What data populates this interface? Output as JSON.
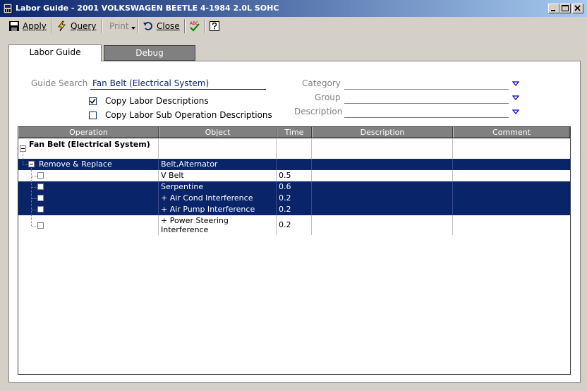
{
  "window": {
    "title": "Labor Guide - 2001 VOLKSWAGEN BEETLE 4-1984 2.0L SOHC"
  },
  "toolbar": {
    "apply": "Apply",
    "query": "Query",
    "print": "Print",
    "close": "Close"
  },
  "tabs": [
    {
      "label": "Labor Guide",
      "active": true
    },
    {
      "label": "Debug",
      "active": false
    }
  ],
  "form": {
    "guide_search_label": "Guide Search",
    "guide_search_value": "Fan Belt (Electrical System)",
    "copy_labor_desc_label": "Copy Labor Descriptions",
    "copy_labor_desc_checked": true,
    "copy_sub_op_label": "Copy Labor Sub Operation Descriptions",
    "copy_sub_op_checked": false,
    "category_label": "Category",
    "group_label": "Group",
    "description_label": "Description"
  },
  "grid": {
    "columns": [
      "Operation",
      "Object",
      "Time",
      "Description",
      "Comment"
    ],
    "rows": [
      {
        "operation": "Fan Belt (Electrical System)",
        "object": "",
        "time": "",
        "selected": false
      },
      {
        "operation": "Remove & Replace",
        "object": "Belt,Alternator",
        "time": "",
        "selected": true
      },
      {
        "operation": "",
        "object": "V Belt",
        "time": "0.5",
        "selected": false
      },
      {
        "operation": "",
        "object": "Serpentine",
        "time": "0.6",
        "selected": true
      },
      {
        "operation": "",
        "object": "+ Air Cond Interference",
        "time": "0.2",
        "selected": true
      },
      {
        "operation": "",
        "object": "+ Air Pump Interference",
        "time": "0.2",
        "selected": true
      },
      {
        "operation": "",
        "object": "+ Power Steering Interference",
        "time": "0.2",
        "selected": false
      }
    ]
  },
  "colors": {
    "titlebar_start": "#0a246a",
    "titlebar_end": "#a6caf0",
    "selection": "#0a246a",
    "window_bg": "#d4d0c8"
  }
}
